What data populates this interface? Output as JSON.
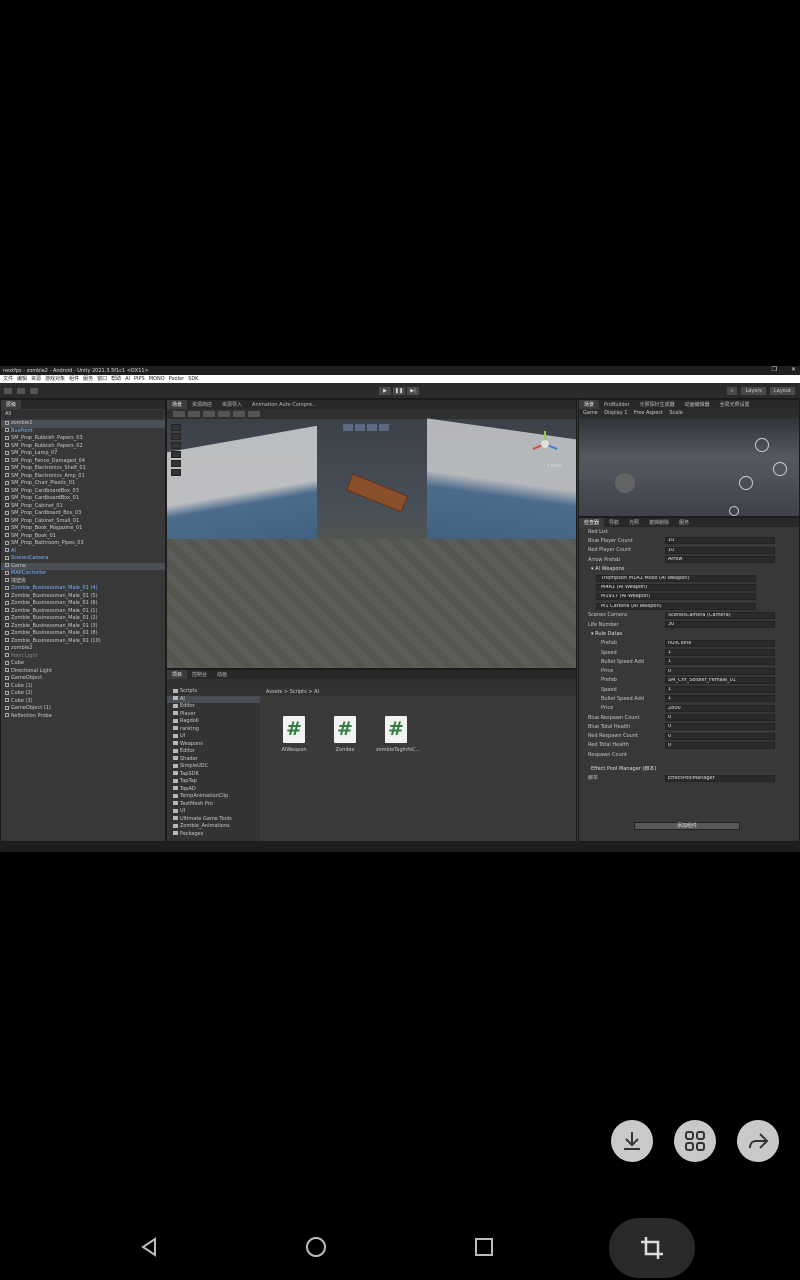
{
  "window": {
    "title": "nextfps - zombie2 - Android - Unity 2021.3.5f1c1 <DX11>",
    "menu": [
      "文件",
      "编辑",
      "资源",
      "游戏对象",
      "组件",
      "服务",
      "窗口",
      "帮助",
      "AI",
      "PIPS",
      "MONO",
      "Pooler",
      "SDK"
    ]
  },
  "toolbar": {
    "layers_label": "Layers",
    "layout_label": "Layout"
  },
  "hierarchy": {
    "tab": "层级",
    "search_placeholder": "All",
    "items": [
      {
        "label": "zombie2",
        "cls": "selected"
      },
      {
        "label": "BusPoint",
        "cls": "blue"
      },
      {
        "label": "SM_Prop_Rubbish_Papers_03",
        "cls": ""
      },
      {
        "label": "SM_Prop_Rubbish_Papers_02",
        "cls": ""
      },
      {
        "label": "SM_Prop_Lamp_07",
        "cls": ""
      },
      {
        "label": "SM_Prop_Fence_Damaged_04",
        "cls": ""
      },
      {
        "label": "SM_Prop_Electronics_Shelf_01",
        "cls": ""
      },
      {
        "label": "SM_Prop_Electronics_Amp_01",
        "cls": ""
      },
      {
        "label": "SM_Prop_Chair_Plastic_01",
        "cls": ""
      },
      {
        "label": "SM_Prop_CardboardBox_03",
        "cls": ""
      },
      {
        "label": "SM_Prop_CardboardBox_01",
        "cls": ""
      },
      {
        "label": "SM_Prop_Cabinet_01",
        "cls": ""
      },
      {
        "label": "SM_Prop_Cardboard_Box_03",
        "cls": ""
      },
      {
        "label": "SM_Prop_Cabinet_Small_01",
        "cls": ""
      },
      {
        "label": "SM_Prop_Book_Magazine_01",
        "cls": ""
      },
      {
        "label": "SM_Prop_Book_01",
        "cls": ""
      },
      {
        "label": "SM_Prop_Bathroom_Pipes_03",
        "cls": ""
      },
      {
        "label": "AI",
        "cls": "blue"
      },
      {
        "label": "ScenesCamera",
        "cls": "blue"
      },
      {
        "label": "Game",
        "cls": "selected"
      },
      {
        "label": "MAPController",
        "cls": "blue"
      },
      {
        "label": "墙壁房",
        "cls": ""
      },
      {
        "label": "Zombie_Businessman_Male_01 (4)",
        "cls": "blue"
      },
      {
        "label": "Zombie_Businessman_Male_01 (5)",
        "cls": ""
      },
      {
        "label": "Zombie_Businessman_Male_01 (6)",
        "cls": ""
      },
      {
        "label": "Zombie_Businessman_Male_01 (1)",
        "cls": ""
      },
      {
        "label": "Zombie_Businessman_Male_01 (2)",
        "cls": ""
      },
      {
        "label": "Zombie_Businessman_Male_01 (3)",
        "cls": ""
      },
      {
        "label": "Zombie_Businessman_Male_01 (8)",
        "cls": ""
      },
      {
        "label": "Zombie_Businessman_Male_01 (10)",
        "cls": ""
      },
      {
        "label": "zombie2",
        "cls": ""
      },
      {
        "label": "Point Light",
        "cls": "dim"
      },
      {
        "label": "Cube",
        "cls": ""
      },
      {
        "label": "Directional Light",
        "cls": ""
      },
      {
        "label": "GameObject",
        "cls": ""
      },
      {
        "label": "Cube (1)",
        "cls": ""
      },
      {
        "label": "Cube (2)",
        "cls": ""
      },
      {
        "label": "Cube (3)",
        "cls": ""
      },
      {
        "label": "GameObject (1)",
        "cls": ""
      },
      {
        "label": "Reflection Probe",
        "cls": ""
      }
    ]
  },
  "scene": {
    "tabs": [
      "场景",
      "资源商店",
      "资源导入",
      "Animation Auto Compre..."
    ],
    "gizmo_label": "< Persp"
  },
  "project": {
    "tabs": [
      "项目",
      "控制台",
      "动画"
    ],
    "breadcrumb": "Assets > Scripts > AI",
    "folders": [
      {
        "label": "Scripts",
        "cls": ""
      },
      {
        "label": "AI",
        "cls": "sel"
      },
      {
        "label": "Editor",
        "cls": ""
      },
      {
        "label": "Player",
        "cls": ""
      },
      {
        "label": "Ragdoll",
        "cls": ""
      },
      {
        "label": "ranking",
        "cls": ""
      },
      {
        "label": "UI",
        "cls": ""
      },
      {
        "label": "Weapons",
        "cls": ""
      },
      {
        "label": "Editor",
        "cls": ""
      },
      {
        "label": "Shader",
        "cls": ""
      },
      {
        "label": "SimpleUDC",
        "cls": ""
      },
      {
        "label": "TapSDK",
        "cls": ""
      },
      {
        "label": "TapTap",
        "cls": ""
      },
      {
        "label": "TapAD",
        "cls": ""
      },
      {
        "label": "TempAnimationClip",
        "cls": ""
      },
      {
        "label": "TextMesh Pro",
        "cls": ""
      },
      {
        "label": "UI",
        "cls": ""
      },
      {
        "label": "Ultimate Game Tools",
        "cls": ""
      },
      {
        "label": "Zombie_Animations",
        "cls": ""
      },
      {
        "label": "Packages",
        "cls": ""
      }
    ],
    "files": [
      "AIWeapon",
      "Zombie",
      "zombieTagInfoC..."
    ]
  },
  "game": {
    "tabs": [
      "场景",
      "ProBuilder",
      "光照探针生成器",
      "动画编辑器",
      "全局光照设置"
    ],
    "display": "Game",
    "display_num": "Display 1",
    "aspect": "Free Aspect",
    "scale": "Scale"
  },
  "inspector": {
    "tabs": [
      "检查器",
      "导航",
      "光照",
      "遮挡剔除",
      "服务"
    ],
    "rows": [
      {
        "kind": "plain",
        "label": "Red List",
        "value": ""
      },
      {
        "kind": "field",
        "label": "Blue Player Count",
        "value": "10"
      },
      {
        "kind": "field",
        "label": "Red Player Count",
        "value": "10"
      },
      {
        "kind": "field",
        "label": "Arrow Prefab",
        "value": "Arrow"
      },
      {
        "kind": "hdr",
        "label": "AI Weapons",
        "value": ""
      },
      {
        "kind": "ref",
        "label": "",
        "value": "Thompson M1A1 Moso (Ai Weapon)"
      },
      {
        "kind": "ref",
        "label": "",
        "value": "M4A1 (Ai Weapon)"
      },
      {
        "kind": "ref",
        "label": "",
        "value": "M1917 (Ai Weapon)"
      },
      {
        "kind": "ref",
        "label": "",
        "value": "M1 Carbine (Ai Weapon)"
      },
      {
        "kind": "field",
        "label": "Scenes Camera",
        "value": "ScenesCamera (Camera)"
      },
      {
        "kind": "field",
        "label": "Life Number",
        "value": "30"
      },
      {
        "kind": "hdr",
        "label": "Rule Datas",
        "value": ""
      },
      {
        "kind": "sub",
        "label": "Prefab",
        "value": "nullClone"
      },
      {
        "kind": "sub",
        "label": "Speed",
        "value": "1"
      },
      {
        "kind": "sub",
        "label": "Bullet Speed Add",
        "value": "1"
      },
      {
        "kind": "sub",
        "label": "Price",
        "value": "0"
      },
      {
        "kind": "sub",
        "label": "Prefab",
        "value": "SM_Chr_Soldier_Female_01"
      },
      {
        "kind": "sub",
        "label": "Speed",
        "value": "1"
      },
      {
        "kind": "sub",
        "label": "Bullet Speed Add",
        "value": "1"
      },
      {
        "kind": "sub",
        "label": "Price",
        "value": "2800"
      },
      {
        "kind": "field",
        "label": "Blue Respawn Count",
        "value": "0"
      },
      {
        "kind": "field",
        "label": "Blue Total Health",
        "value": "0"
      },
      {
        "kind": "field",
        "label": "Red Respawn Count",
        "value": "0"
      },
      {
        "kind": "field",
        "label": "Red Total Health",
        "value": "0"
      },
      {
        "kind": "plain",
        "label": "Respawn Count",
        "value": ""
      }
    ],
    "component_title": "Effect Pool Manager  (脚本)",
    "script_label": "脚本",
    "script_value": "EffectPoolManager",
    "add_component": "添加组件"
  }
}
